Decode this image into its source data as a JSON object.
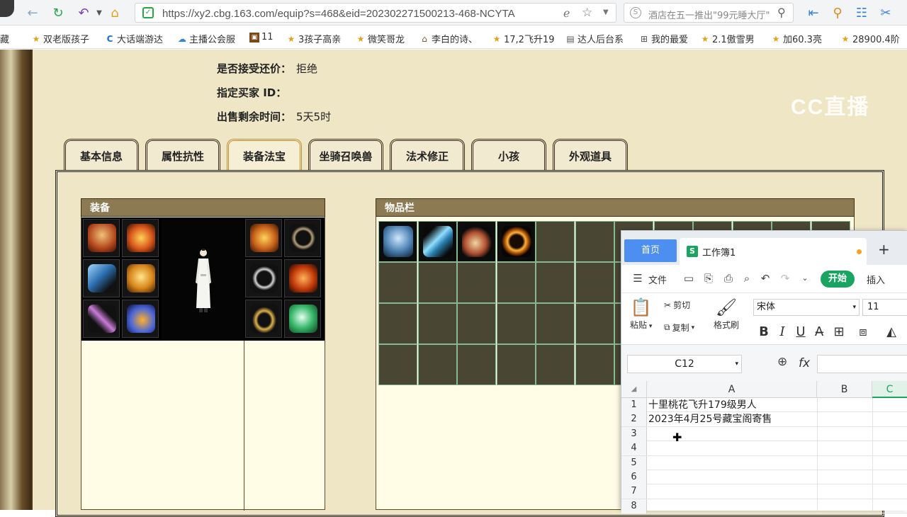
{
  "browser": {
    "url": "https://xy2.cbg.163.com/equip?s=468&eid=202302271500213-468-NCYTA",
    "search_text": "酒店在五一推出\"99元睡大厅\"",
    "bookmarks": [
      {
        "label": "藏",
        "icon": "folder-icon"
      },
      {
        "label": "双老版孩子",
        "icon": "star-icon"
      },
      {
        "label": "大话端游达",
        "icon": "c-icon"
      },
      {
        "label": "主播公会服",
        "icon": "cloud-icon"
      },
      {
        "label": "11",
        "icon": "game-icon"
      },
      {
        "label": "3孩子高亲",
        "icon": "star-icon"
      },
      {
        "label": "微笑哥龙",
        "icon": "star-icon"
      },
      {
        "label": "李白的诗、",
        "icon": "hat-icon"
      },
      {
        "label": "17,2飞升19",
        "icon": "star-icon"
      },
      {
        "label": "达人后台系",
        "icon": "doc-icon"
      },
      {
        "label": "我的最爱",
        "icon": "grid-icon"
      },
      {
        "label": "2.1傲雪男",
        "icon": "star-icon"
      },
      {
        "label": "加60.3亮",
        "icon": "star-icon"
      },
      {
        "label": "28900.4阶",
        "icon": "star-icon"
      }
    ]
  },
  "watermark": "CC直播",
  "info": {
    "counter_offer_label": "是否接受还价：",
    "counter_offer_value": "拒绝",
    "buyer_id_label": "指定买家 ID：",
    "buyer_id_value": "",
    "remaining_label": "出售剩余时间：",
    "remaining_value": "5天5时"
  },
  "tabs": [
    {
      "label": "基本信息",
      "active": false
    },
    {
      "label": "属性抗性",
      "active": false
    },
    {
      "label": "装备法宝",
      "active": true
    },
    {
      "label": "坐骑召唤兽",
      "active": false
    },
    {
      "label": "法术修正",
      "active": false
    },
    {
      "label": "小孩",
      "active": false
    },
    {
      "label": "外观道具",
      "active": false
    }
  ],
  "equipment": {
    "title": "装备",
    "items": [
      "red-hat-icon",
      "flame-crown-icon",
      "blue-sword-icon",
      "yellow-robe-icon",
      "whip-icon",
      "orange-boots-icon",
      "gold-mask-icon",
      "bead-bracelet-icon",
      "silver-ring-icon",
      "fire-orb-icon",
      "gold-ring-icon",
      "jade-orb-icon"
    ]
  },
  "inventory": {
    "title": "物品栏",
    "items": [
      "blue-robe-icon",
      "crystal-card-icon",
      "gourd-charm-icon",
      "fire-ring-icon"
    ]
  },
  "spreadsheet": {
    "home_tab": "首页",
    "book_title": "工作簿1",
    "menu_file": "文件",
    "menu_start": "开始",
    "menu_insert": "插入",
    "paste": "粘贴",
    "cut": "剪切",
    "copy": "复制",
    "format_painter": "格式刷",
    "font_name": "宋体",
    "font_size": "11",
    "name_box": "C12",
    "columns": [
      "A",
      "B",
      "C"
    ],
    "rows": [
      {
        "num": "1",
        "a": "十里桃花飞升179级男人"
      },
      {
        "num": "2",
        "a": "2023年4月25号藏宝阁寄售"
      },
      {
        "num": "3",
        "a": ""
      },
      {
        "num": "4",
        "a": ""
      },
      {
        "num": "5",
        "a": ""
      },
      {
        "num": "6",
        "a": ""
      },
      {
        "num": "7",
        "a": ""
      },
      {
        "num": "8",
        "a": ""
      }
    ]
  }
}
